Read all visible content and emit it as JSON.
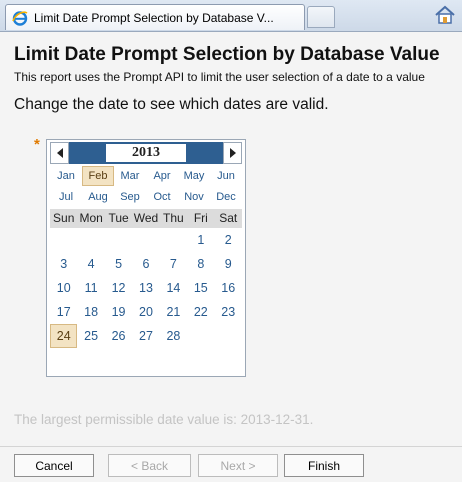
{
  "browser": {
    "tab_title": "Limit Date Prompt Selection by Database V...",
    "icons": [
      "ie-icon",
      "home-icon"
    ]
  },
  "page": {
    "title": "Limit Date Prompt Selection by Database Value",
    "description": "This report uses the Prompt API to limit the user selection of a date to a value",
    "instruction": "Change the date to see which dates are valid.",
    "required_marker": "*"
  },
  "calendar": {
    "year": "2013",
    "selected_month": "Feb",
    "months": [
      [
        "Jan",
        "Feb",
        "Mar",
        "Apr",
        "May",
        "Jun"
      ],
      [
        "Jul",
        "Aug",
        "Sep",
        "Oct",
        "Nov",
        "Dec"
      ]
    ],
    "weekdays": [
      "Sun",
      "Mon",
      "Tue",
      "Wed",
      "Thu",
      "Fri",
      "Sat"
    ],
    "weeks": [
      [
        "",
        "",
        "",
        "",
        "",
        "1",
        "2"
      ],
      [
        "3",
        "4",
        "5",
        "6",
        "7",
        "8",
        "9"
      ],
      [
        "10",
        "11",
        "12",
        "13",
        "14",
        "15",
        "16"
      ],
      [
        "17",
        "18",
        "19",
        "20",
        "21",
        "22",
        "23"
      ],
      [
        "24",
        "25",
        "26",
        "27",
        "28",
        "",
        ""
      ]
    ],
    "selected_day": "24"
  },
  "largest_value_text": "The largest permissible date value is: 2013-12-31.",
  "buttons": {
    "cancel": "Cancel",
    "back": "< Back",
    "next": "Next >",
    "finish": "Finish"
  },
  "colors": {
    "year_bar": "#2e5f91",
    "link_text": "#275a8e",
    "selected_bg": "#f3e3c3",
    "required": "#e07a00"
  }
}
